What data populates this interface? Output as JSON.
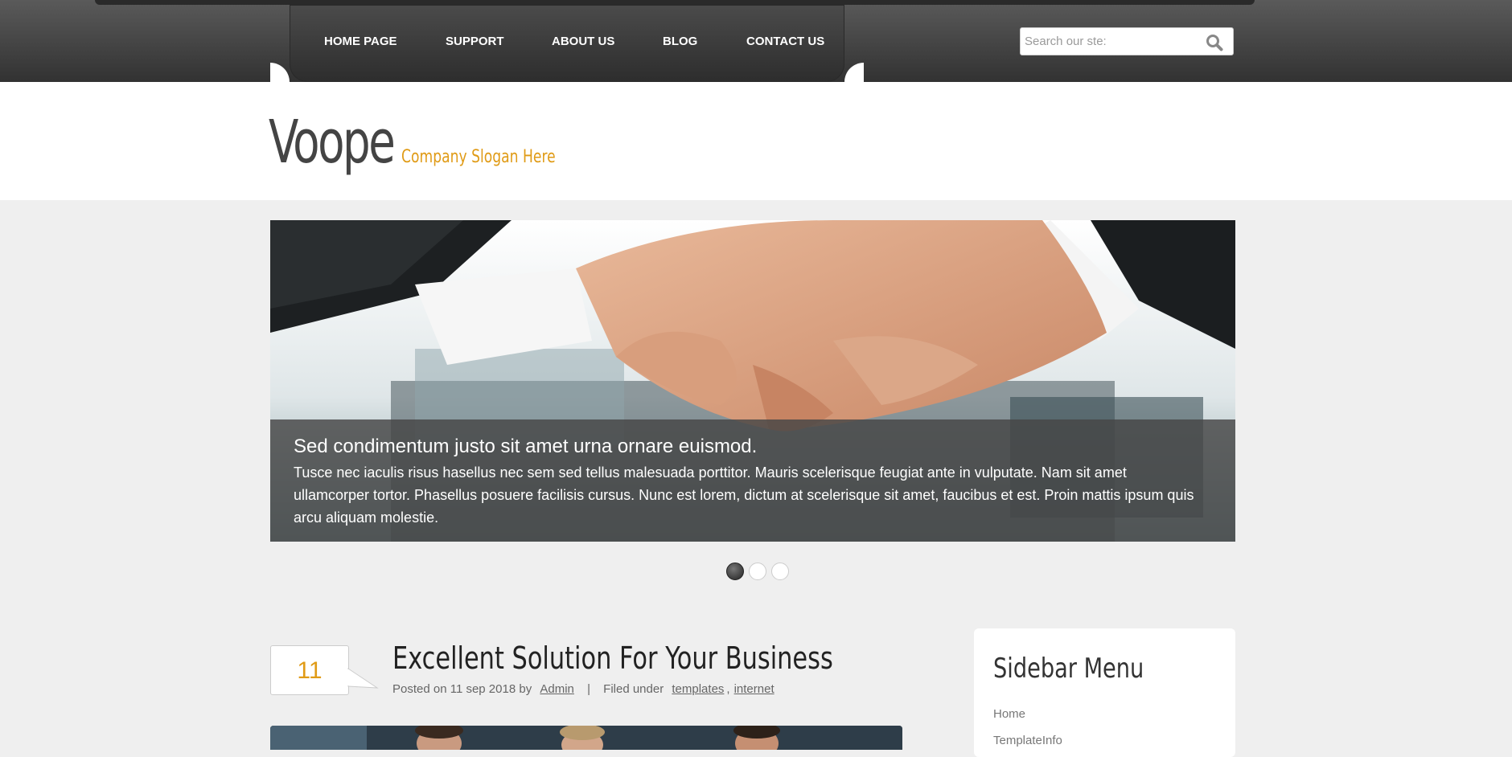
{
  "nav": {
    "items": [
      {
        "label": "HOME PAGE"
      },
      {
        "label": "SUPPORT"
      },
      {
        "label": "ABOUT US"
      },
      {
        "label": "BLOG"
      },
      {
        "label": "CONTACT US"
      }
    ],
    "search_placeholder": "Search our ste:",
    "search_icon": "search-icon"
  },
  "header": {
    "logo": "Voope",
    "slogan": "Company Slogan Here"
  },
  "slider": {
    "caption_title": "Sed condimentum justo sit amet urna ornare euismod.",
    "caption_text": "Tusce nec iaculis risus hasellus nec sem sed tellus malesuada porttitor. Mauris scelerisque feugiat ante in vulputate. Nam sit amet ullamcorper tortor. Phasellus posuere facilisis cursus. Nunc est lorem, dictum at scelerisque sit amet, faucibus et est. Proin mattis ipsum quis arcu aliquam molestie.",
    "active_slide": 1,
    "slide_count": 3
  },
  "post": {
    "day": "11",
    "title": "Excellent Solution For Your Business",
    "posted_on": "Posted on 11 sep 2018 by",
    "author": "Admin",
    "separator": "|",
    "filed_under": "Filed under",
    "tags": [
      "templates",
      "internet"
    ],
    "tag_separator": ","
  },
  "sidebar": {
    "title": "Sidebar Menu",
    "items": [
      "Home",
      "TemplateInfo"
    ]
  },
  "colors": {
    "accent": "#e09b16",
    "nav_dark": "#3a3a3a"
  }
}
